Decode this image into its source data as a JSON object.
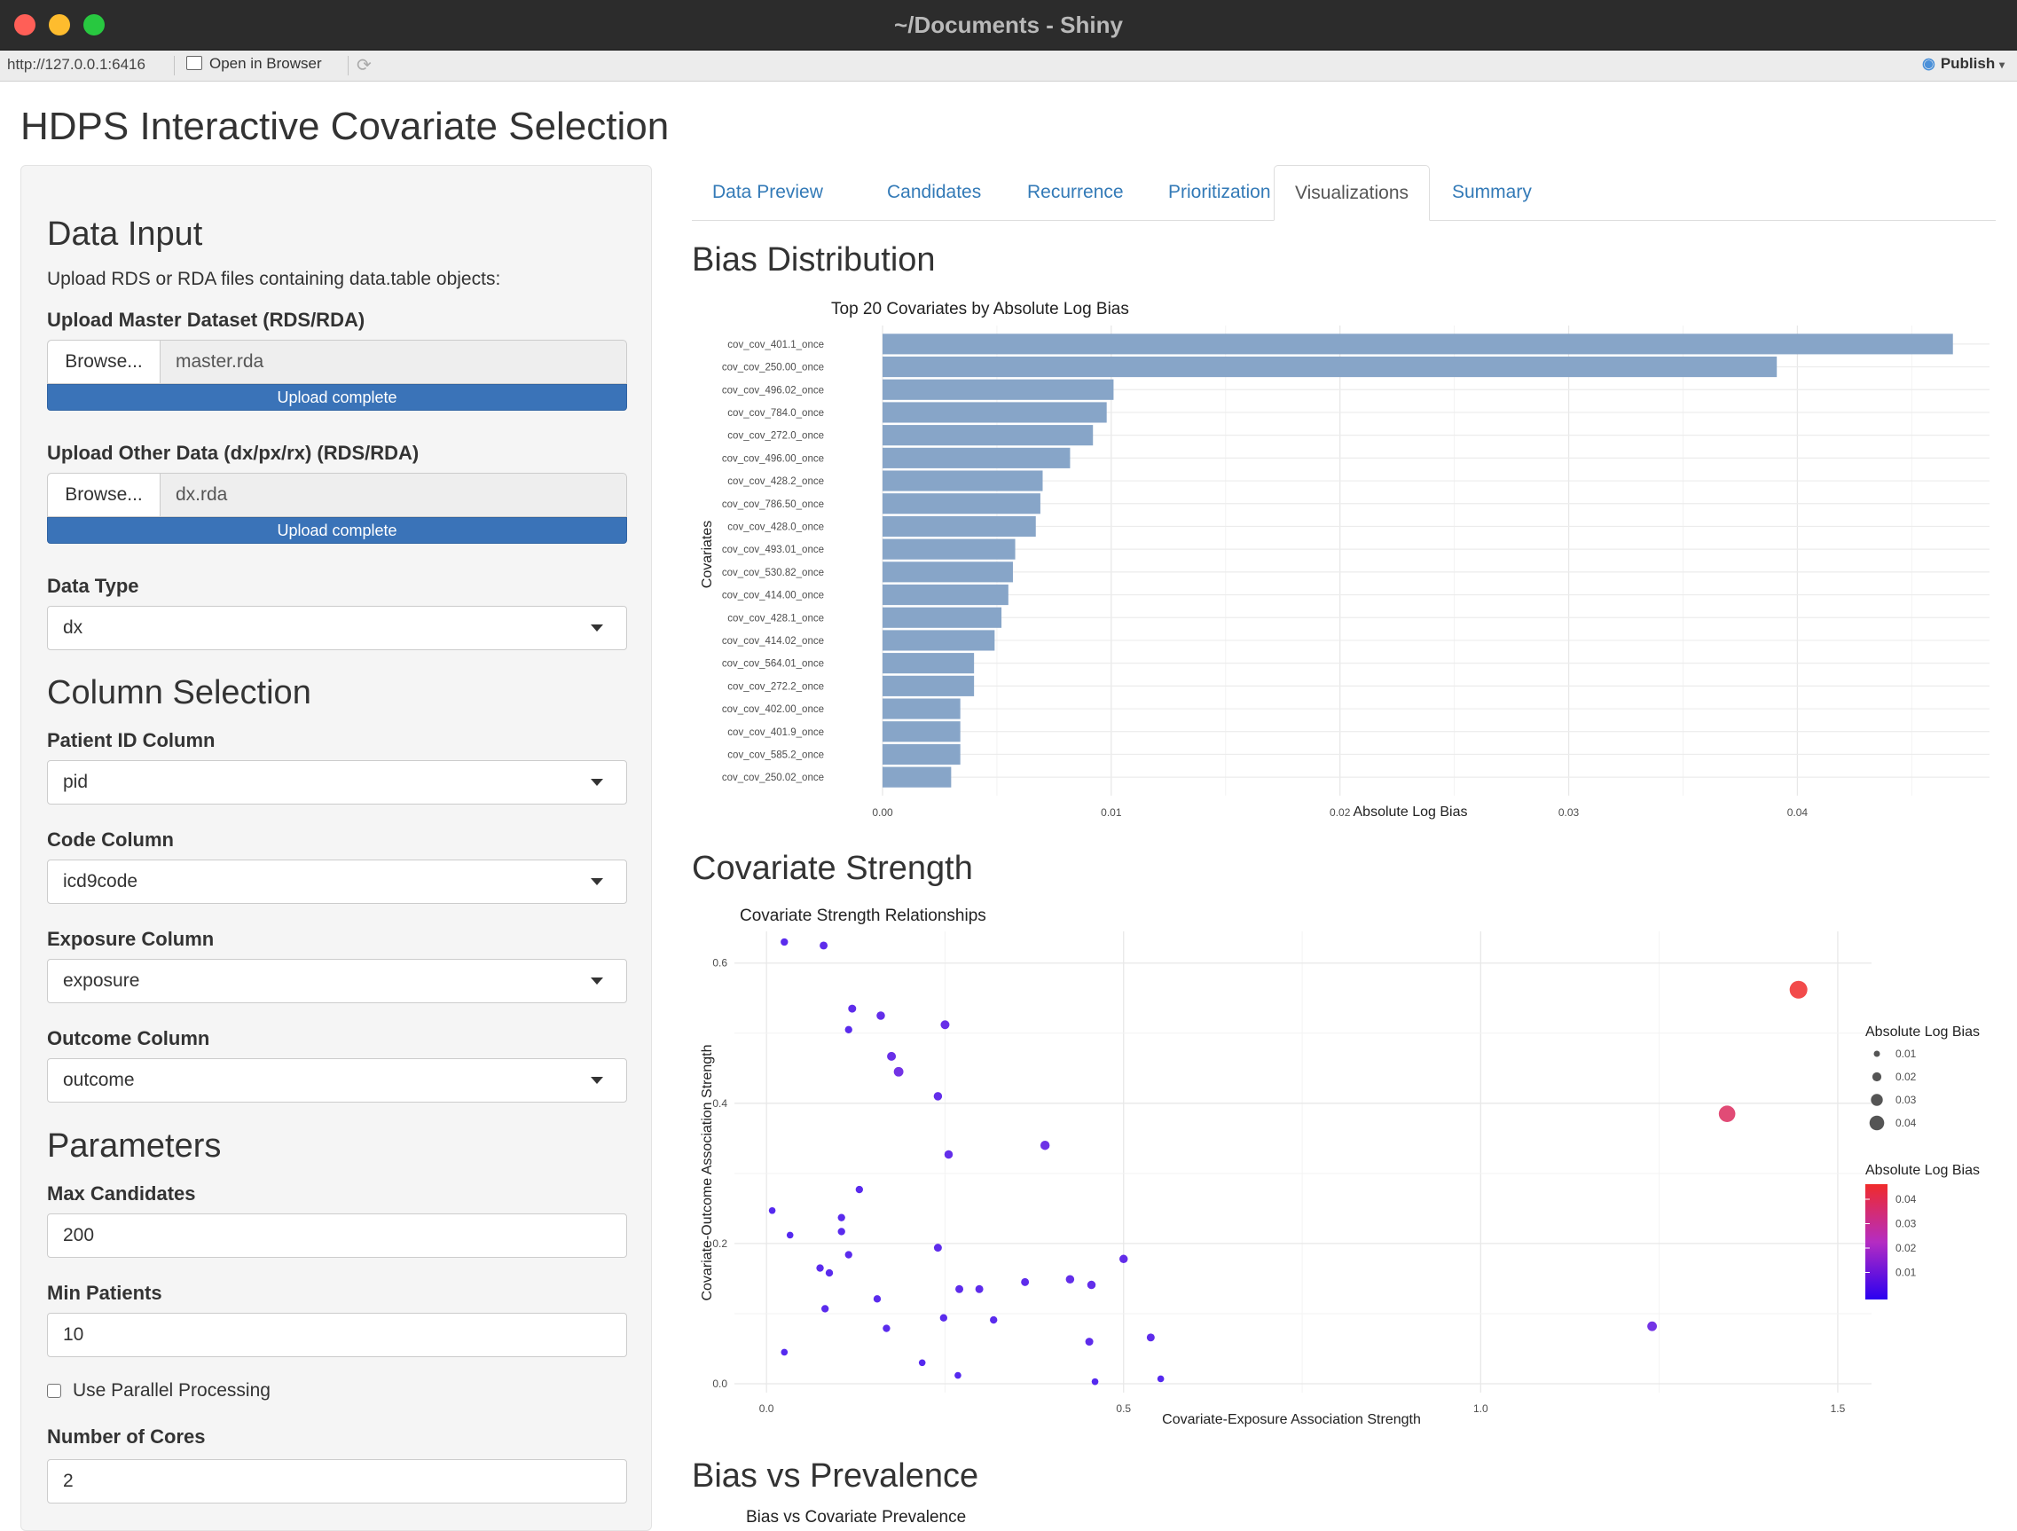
{
  "window": {
    "title": "~/Documents - Shiny"
  },
  "toolbar": {
    "url": "http://127.0.0.1:6416",
    "open_in_browser": "Open in Browser",
    "publish": "Publish"
  },
  "app": {
    "title": "HDPS Interactive Covariate Selection"
  },
  "sidebar": {
    "data_input": {
      "heading": "Data Input",
      "description": "Upload RDS or RDA files containing data.table objects:",
      "master": {
        "label": "Upload Master Dataset (RDS/RDA)",
        "button": "Browse...",
        "filename": "master.rda",
        "progress": "Upload complete"
      },
      "other": {
        "label": "Upload Other Data (dx/px/rx) (RDS/RDA)",
        "button": "Browse...",
        "filename": "dx.rda",
        "progress": "Upload complete"
      },
      "data_type": {
        "label": "Data Type",
        "value": "dx"
      }
    },
    "column_selection": {
      "heading": "Column Selection",
      "patient_id": {
        "label": "Patient ID Column",
        "value": "pid"
      },
      "code": {
        "label": "Code Column",
        "value": "icd9code"
      },
      "exposure": {
        "label": "Exposure Column",
        "value": "exposure"
      },
      "outcome": {
        "label": "Outcome Column",
        "value": "outcome"
      }
    },
    "parameters": {
      "heading": "Parameters",
      "max_candidates": {
        "label": "Max Candidates",
        "value": "200"
      },
      "min_patients": {
        "label": "Min Patients",
        "value": "10"
      },
      "parallel": {
        "label": "Use Parallel Processing",
        "checked": false
      },
      "cores": {
        "label": "Number of Cores",
        "value": "2"
      }
    }
  },
  "tabs": [
    {
      "label": "Data Preview",
      "active": false
    },
    {
      "label": "Candidates",
      "active": false
    },
    {
      "label": "Recurrence",
      "active": false
    },
    {
      "label": "Prioritization",
      "active": false
    },
    {
      "label": "Visualizations",
      "active": true
    },
    {
      "label": "Summary",
      "active": false
    }
  ],
  "sections": {
    "bias_distribution": "Bias Distribution",
    "covariate_strength": "Covariate Strength",
    "bias_vs_prevalence": "Bias vs Prevalence"
  },
  "bias_vs_prevalence_chart_title": "Bias vs Covariate Prevalence",
  "chart_data": [
    {
      "type": "bar",
      "orientation": "horizontal",
      "title": "Top 20 Covariates by Absolute Log Bias",
      "xlabel": "Absolute Log Bias",
      "ylabel": "Covariates",
      "color": "#87a5c8",
      "xlim": [
        0,
        0.0484
      ],
      "xticks": [
        "0.00",
        "0.01",
        "0.02",
        "0.03",
        "0.04"
      ],
      "categories": [
        "cov_cov_401.1_once",
        "cov_cov_250.00_once",
        "cov_cov_496.02_once",
        "cov_cov_784.0_once",
        "cov_cov_272.0_once",
        "cov_cov_496.00_once",
        "cov_cov_428.2_once",
        "cov_cov_786.50_once",
        "cov_cov_428.0_once",
        "cov_cov_493.01_once",
        "cov_cov_530.82_once",
        "cov_cov_414.00_once",
        "cov_cov_428.1_once",
        "cov_cov_414.02_once",
        "cov_cov_564.01_once",
        "cov_cov_272.2_once",
        "cov_cov_402.00_once",
        "cov_cov_401.9_once",
        "cov_cov_585.2_once",
        "cov_cov_250.02_once"
      ],
      "values": [
        0.0468,
        0.0391,
        0.0101,
        0.0098,
        0.0092,
        0.0082,
        0.007,
        0.0069,
        0.0067,
        0.0058,
        0.0057,
        0.0055,
        0.0052,
        0.0049,
        0.004,
        0.004,
        0.0034,
        0.0034,
        0.0034,
        0.003
      ],
      "grid": true
    },
    {
      "type": "scatter",
      "title": "Covariate Strength Relationships",
      "xlabel": "Covariate-Exposure Association Strength",
      "ylabel": "Covariate-Outcome Association Strength",
      "xlim": [
        -0.03,
        1.51
      ],
      "ylim": [
        0,
        0.63
      ],
      "xticks": [
        "0.0",
        "0.5",
        "1.0",
        "1.5"
      ],
      "yticks": [
        "0.0",
        "0.2",
        "0.4",
        "0.6"
      ],
      "legend_size": {
        "title": "Absolute Log Bias",
        "labels": [
          "0.01",
          "0.02",
          "0.03",
          "0.04"
        ],
        "position": "right"
      },
      "legend_color": {
        "title": "Absolute Log Bias",
        "labels": [
          "0.04",
          "0.03",
          "0.02",
          "0.01"
        ],
        "low": "#2b00f0",
        "high": "#f02b2b",
        "position": "right"
      },
      "points": [
        {
          "x": 0.025,
          "y": 0.63,
          "bias": 0.003
        },
        {
          "x": 0.08,
          "y": 0.625,
          "bias": 0.004
        },
        {
          "x": 0.12,
          "y": 0.535,
          "bias": 0.004
        },
        {
          "x": 0.115,
          "y": 0.505,
          "bias": 0.003
        },
        {
          "x": 0.16,
          "y": 0.525,
          "bias": 0.005
        },
        {
          "x": 0.25,
          "y": 0.512,
          "bias": 0.006
        },
        {
          "x": 0.175,
          "y": 0.467,
          "bias": 0.006
        },
        {
          "x": 0.185,
          "y": 0.445,
          "bias": 0.008
        },
        {
          "x": 0.24,
          "y": 0.41,
          "bias": 0.005
        },
        {
          "x": 0.255,
          "y": 0.327,
          "bias": 0.005
        },
        {
          "x": 0.39,
          "y": 0.34,
          "bias": 0.007
        },
        {
          "x": 0.13,
          "y": 0.277,
          "bias": 0.003
        },
        {
          "x": 0.008,
          "y": 0.247,
          "bias": 0.002
        },
        {
          "x": 0.105,
          "y": 0.237,
          "bias": 0.003
        },
        {
          "x": 0.105,
          "y": 0.217,
          "bias": 0.003
        },
        {
          "x": 0.033,
          "y": 0.212,
          "bias": 0.002
        },
        {
          "x": 0.24,
          "y": 0.194,
          "bias": 0.004
        },
        {
          "x": 0.115,
          "y": 0.184,
          "bias": 0.003
        },
        {
          "x": 0.5,
          "y": 0.178,
          "bias": 0.005
        },
        {
          "x": 0.075,
          "y": 0.165,
          "bias": 0.003
        },
        {
          "x": 0.088,
          "y": 0.158,
          "bias": 0.003
        },
        {
          "x": 0.425,
          "y": 0.149,
          "bias": 0.005
        },
        {
          "x": 0.362,
          "y": 0.145,
          "bias": 0.004
        },
        {
          "x": 0.455,
          "y": 0.141,
          "bias": 0.005
        },
        {
          "x": 0.27,
          "y": 0.135,
          "bias": 0.004
        },
        {
          "x": 0.298,
          "y": 0.135,
          "bias": 0.004
        },
        {
          "x": 0.155,
          "y": 0.121,
          "bias": 0.003
        },
        {
          "x": 0.082,
          "y": 0.107,
          "bias": 0.003
        },
        {
          "x": 0.248,
          "y": 0.094,
          "bias": 0.003
        },
        {
          "x": 0.318,
          "y": 0.091,
          "bias": 0.003
        },
        {
          "x": 0.168,
          "y": 0.079,
          "bias": 0.003
        },
        {
          "x": 0.538,
          "y": 0.066,
          "bias": 0.004
        },
        {
          "x": 0.452,
          "y": 0.06,
          "bias": 0.004
        },
        {
          "x": 0.025,
          "y": 0.045,
          "bias": 0.002
        },
        {
          "x": 0.218,
          "y": 0.03,
          "bias": 0.002
        },
        {
          "x": 0.268,
          "y": 0.012,
          "bias": 0.002
        },
        {
          "x": 0.552,
          "y": 0.007,
          "bias": 0.002
        },
        {
          "x": 0.46,
          "y": 0.003,
          "bias": 0.002
        },
        {
          "x": 1.24,
          "y": 0.082,
          "bias": 0.008
        },
        {
          "x": 1.345,
          "y": 0.385,
          "bias": 0.039
        },
        {
          "x": 1.445,
          "y": 0.562,
          "bias": 0.047
        }
      ],
      "grid": true
    }
  ]
}
